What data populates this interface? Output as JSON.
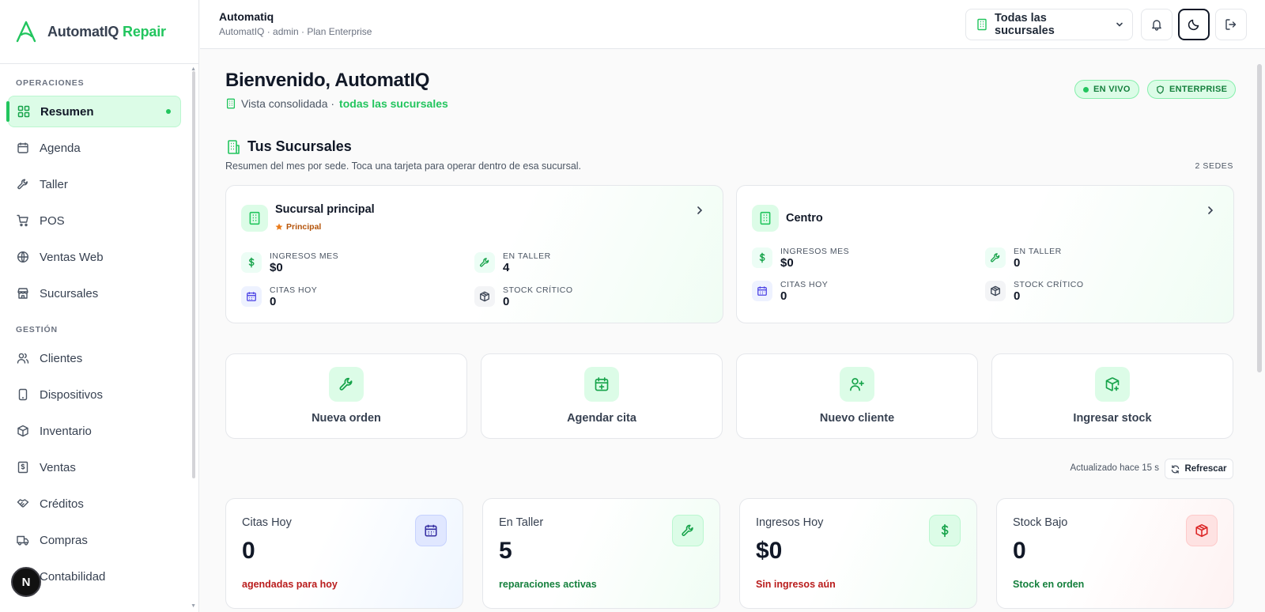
{
  "brand": {
    "name": "AutomatIQ",
    "accent": "Repair"
  },
  "sidebar": {
    "section_ops": "OPERACIONES",
    "section_mgmt": "GESTIÓN",
    "items": [
      {
        "label": "Resumen",
        "icon": "dashboard-icon",
        "active": true
      },
      {
        "label": "Agenda",
        "icon": "calendar-icon"
      },
      {
        "label": "Taller",
        "icon": "wrench-icon"
      },
      {
        "label": "POS",
        "icon": "cart-icon"
      },
      {
        "label": "Ventas Web",
        "icon": "globe-icon"
      },
      {
        "label": "Sucursales",
        "icon": "store-icon"
      },
      {
        "label": "Clientes",
        "icon": "users-icon"
      },
      {
        "label": "Dispositivos",
        "icon": "phone-icon"
      },
      {
        "label": "Inventario",
        "icon": "box-icon"
      },
      {
        "label": "Ventas",
        "icon": "receipt-icon"
      },
      {
        "label": "Créditos",
        "icon": "handshake-icon"
      },
      {
        "label": "Compras",
        "icon": "truck-icon"
      },
      {
        "label": "Contabilidad",
        "icon": "ledger-icon"
      }
    ],
    "badge": "N"
  },
  "header": {
    "title": "Automatiq",
    "subtitle": "AutomatIQ · admin · Plan Enterprise",
    "branch_select": "Todas las sucursales"
  },
  "welcome": {
    "title": "Bienvenido, AutomatIQ",
    "sub_prefix": "Vista consolidada ·",
    "sub_highlight": "todas las sucursales",
    "pill_live": "EN VIVO",
    "pill_plan": "ENTERPRISE"
  },
  "branches": {
    "title": "Tus Sucursales",
    "subtitle": "Resumen del mes por sede. Toca una tarjeta para operar dentro de esa sucursal.",
    "count": "2 SEDES",
    "cards": [
      {
        "name": "Sucursal principal",
        "tag": "Principal",
        "metrics": [
          {
            "label": "INGRESOS MES",
            "value": "$0"
          },
          {
            "label": "EN TALLER",
            "value": "4"
          },
          {
            "label": "CITAS HOY",
            "value": "0"
          },
          {
            "label": "STOCK CRÍTICO",
            "value": "0"
          }
        ]
      },
      {
        "name": "Centro",
        "tag": "",
        "metrics": [
          {
            "label": "INGRESOS MES",
            "value": "$0"
          },
          {
            "label": "EN TALLER",
            "value": "0"
          },
          {
            "label": "CITAS HOY",
            "value": "0"
          },
          {
            "label": "STOCK CRÍTICO",
            "value": "0"
          }
        ]
      }
    ]
  },
  "actions": [
    {
      "label": "Nueva orden",
      "icon": "wrench-icon"
    },
    {
      "label": "Agendar cita",
      "icon": "calendar-plus-icon"
    },
    {
      "label": "Nuevo cliente",
      "icon": "user-plus-icon"
    },
    {
      "label": "Ingresar stock",
      "icon": "package-plus-icon"
    }
  ],
  "updated": {
    "text": "Actualizado hace 15 s",
    "refresh": "Refrescar"
  },
  "stats": [
    {
      "title": "Citas Hoy",
      "value": "0",
      "note": "agendadas para hoy",
      "tone": "red"
    },
    {
      "title": "En Taller",
      "value": "5",
      "note": "reparaciones activas",
      "tone": "green"
    },
    {
      "title": "Ingresos Hoy",
      "value": "$0",
      "note": "Sin ingresos aún",
      "tone": "red"
    },
    {
      "title": "Stock Bajo",
      "value": "0",
      "note": "Stock en orden",
      "tone": "green"
    }
  ],
  "colors": {
    "accent": "#22c55e",
    "accent_dark": "#15803d",
    "danger": "#b91c1c",
    "warning": "#b45309"
  }
}
